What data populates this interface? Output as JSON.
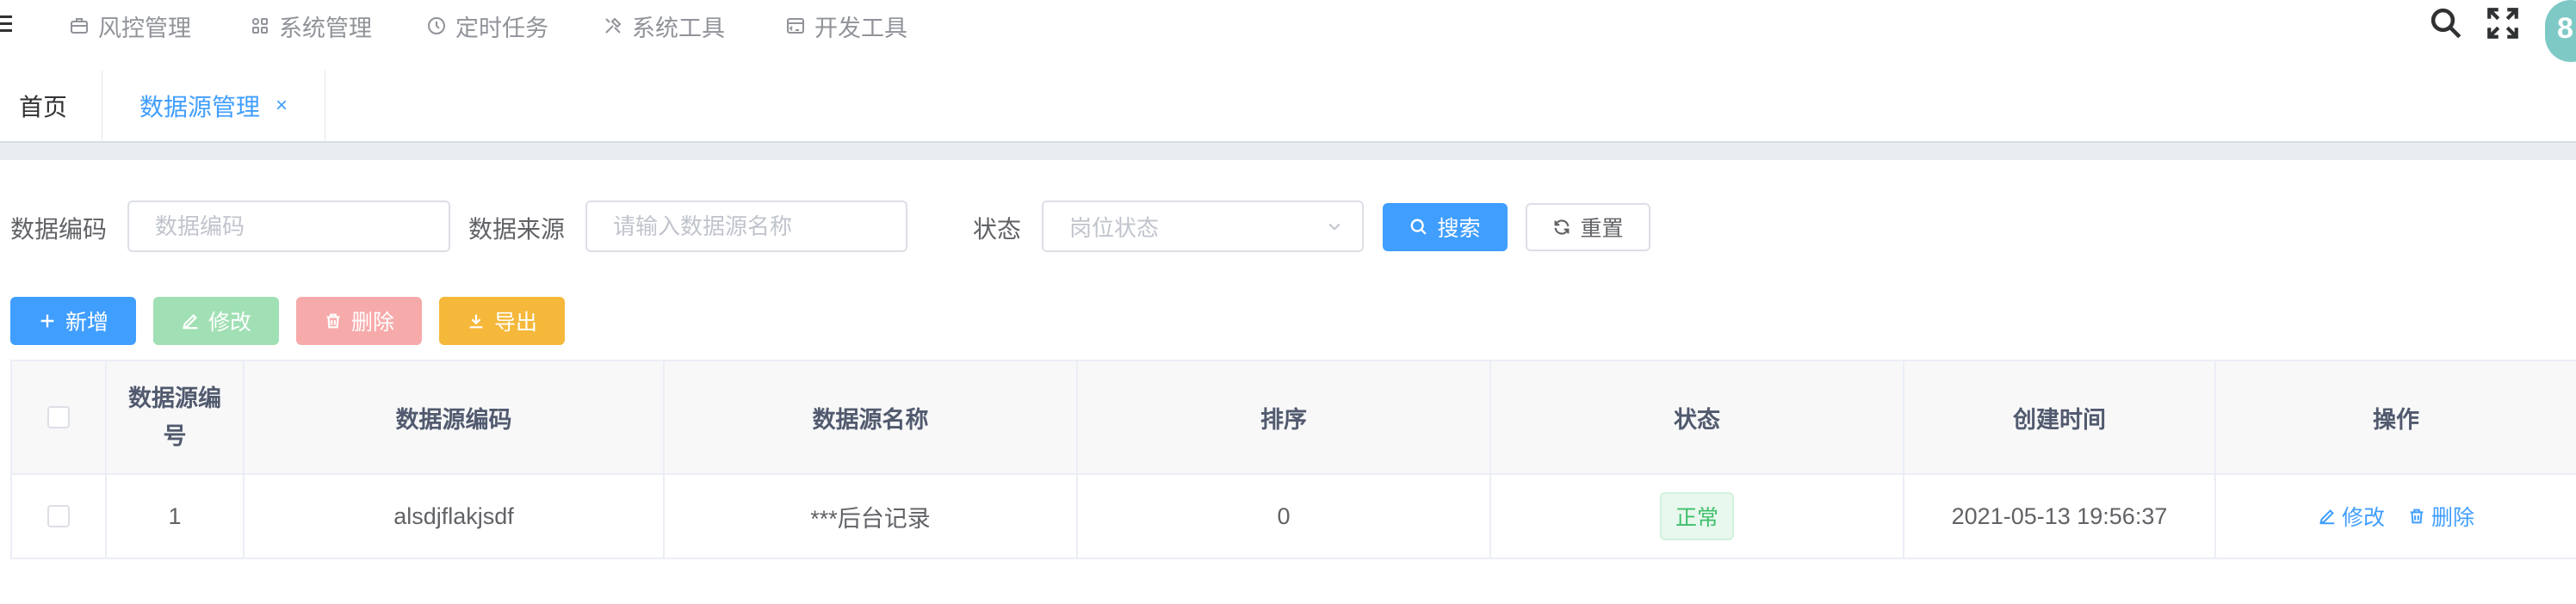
{
  "nav": {
    "items": [
      {
        "label": "风控管理",
        "icon": "briefcase-icon"
      },
      {
        "label": "系统管理",
        "icon": "grid-icon"
      },
      {
        "label": "定时任务",
        "icon": "clock-icon"
      },
      {
        "label": "系统工具",
        "icon": "tools-icon"
      },
      {
        "label": "开发工具",
        "icon": "code-window-icon"
      }
    ],
    "avatar_text": "8"
  },
  "tabs": [
    {
      "label": "首页",
      "active": false
    },
    {
      "label": "数据源管理",
      "active": true,
      "close": "×"
    }
  ],
  "search": {
    "code_label": "数据编码",
    "code_placeholder": "数据编码",
    "source_label": "数据来源",
    "source_placeholder": "请输入数据源名称",
    "status_label": "状态",
    "status_placeholder": "岗位状态",
    "search_button": "搜索",
    "reset_button": "重置"
  },
  "toolbar": {
    "add": "新增",
    "edit": "修改",
    "delete": "删除",
    "export": "导出"
  },
  "table": {
    "headers": [
      "数据源编\n号",
      "数据源编码",
      "数据源名称",
      "排序",
      "状态",
      "创建时间",
      "操作"
    ],
    "rows": [
      {
        "id": "1",
        "code": "alsdjflakjsdf",
        "name": "***后台记录",
        "sort": "0",
        "status": "正常",
        "created": "2021-05-13 19:56:37",
        "edit": "修改",
        "delete": "删除"
      }
    ]
  },
  "colors": {
    "primary": "#409eff",
    "success_light": "#a0e0b4",
    "danger_light": "#f7aaaa",
    "warning": "#f5b83a",
    "status_green": "#3fbf6b"
  }
}
